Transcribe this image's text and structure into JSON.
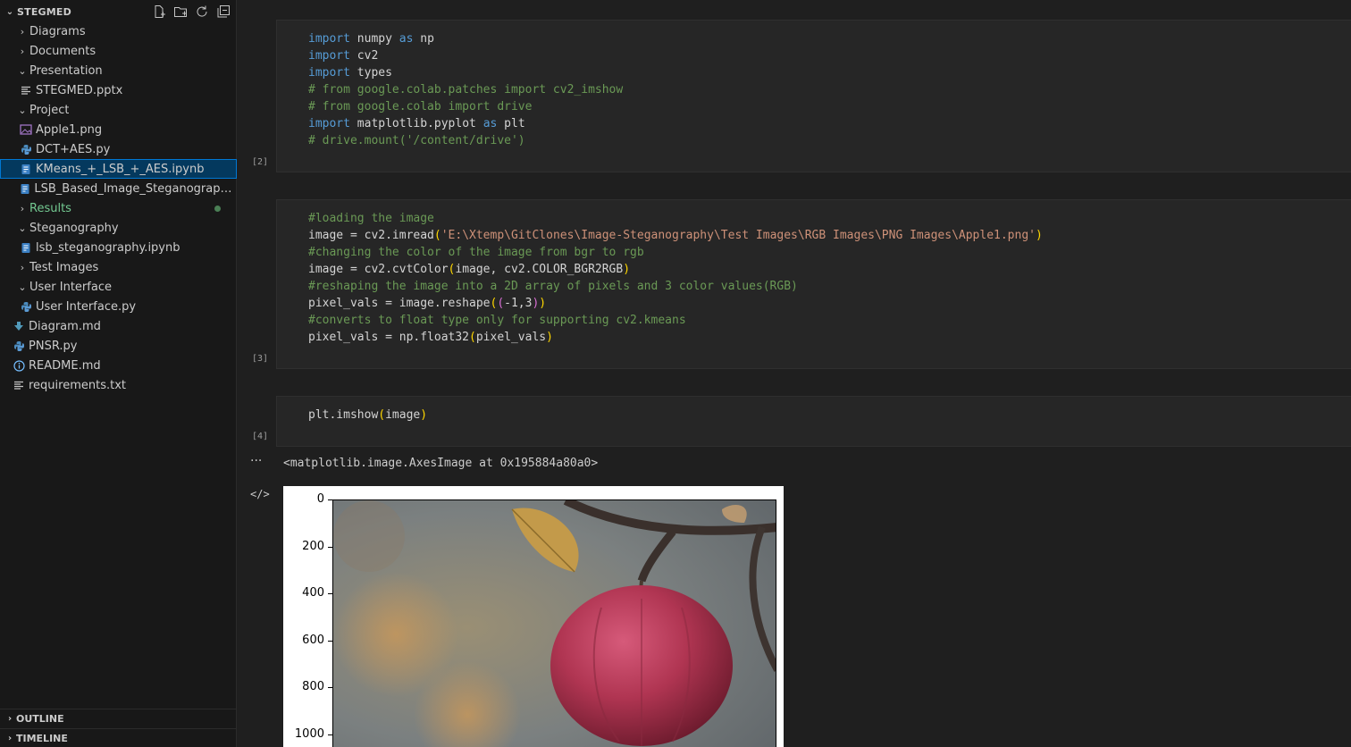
{
  "explorer": {
    "title": "STEGMED",
    "items": [
      {
        "label": "Diagrams",
        "type": "folder",
        "open": false,
        "depth": 0
      },
      {
        "label": "Documents",
        "type": "folder",
        "open": false,
        "depth": 0
      },
      {
        "label": "Presentation",
        "type": "folder",
        "open": true,
        "depth": 0
      },
      {
        "label": "STEGMED.pptx",
        "type": "file-lines",
        "depth": 1
      },
      {
        "label": "Project",
        "type": "folder",
        "open": true,
        "depth": 0
      },
      {
        "label": "Apple1.png",
        "type": "file-image",
        "depth": 1
      },
      {
        "label": "DCT+AES.py",
        "type": "file-python",
        "depth": 1
      },
      {
        "label": "KMeans_+_LSB_+_AES.ipynb",
        "type": "file-notebook",
        "depth": 1,
        "selected": true
      },
      {
        "label": "LSB_Based_Image_Steganography.ipy...",
        "type": "file-notebook",
        "depth": 1
      },
      {
        "label": "Results",
        "type": "folder",
        "open": false,
        "depth": 0,
        "modified": true
      },
      {
        "label": "Steganography",
        "type": "folder",
        "open": true,
        "depth": 0
      },
      {
        "label": "lsb_steganography.ipynb",
        "type": "file-notebook",
        "depth": 1
      },
      {
        "label": "Test Images",
        "type": "folder",
        "open": false,
        "depth": 0
      },
      {
        "label": "User Interface",
        "type": "folder",
        "open": true,
        "depth": 0
      },
      {
        "label": "User Interface.py",
        "type": "file-python",
        "depth": 1
      },
      {
        "label": "Diagram.md",
        "type": "file-markdown",
        "depth": 0
      },
      {
        "label": "PNSR.py",
        "type": "file-python",
        "depth": 0
      },
      {
        "label": "README.md",
        "type": "file-info",
        "depth": 0
      },
      {
        "label": "requirements.txt",
        "type": "file-lines",
        "depth": 0
      }
    ]
  },
  "panes": {
    "outline": "OUTLINE",
    "timeline": "TIMELINE"
  },
  "cells": [
    {
      "exec": "[2]",
      "lines": [
        [
          [
            "kw",
            "import"
          ],
          [
            "t",
            " numpy "
          ],
          [
            "kw",
            "as"
          ],
          [
            "t",
            " np"
          ]
        ],
        [
          [
            "kw",
            "import"
          ],
          [
            "t",
            " cv2"
          ]
        ],
        [
          [
            "kw",
            "import"
          ],
          [
            "t",
            " types"
          ]
        ],
        [
          [
            "cm",
            "# from google.colab.patches import cv2_imshow"
          ]
        ],
        [
          [
            "cm",
            "# from google.colab import drive"
          ]
        ],
        [
          [
            "kw",
            "import"
          ],
          [
            "t",
            " matplotlib.pyplot "
          ],
          [
            "kw",
            "as"
          ],
          [
            "t",
            " plt"
          ]
        ],
        [
          [
            "cm",
            "# drive.mount('/content/drive')"
          ]
        ]
      ]
    },
    {
      "exec": "[3]",
      "lines": [
        [
          [
            "cm",
            "#loading the image"
          ]
        ],
        [
          [
            "t",
            "image = cv2.imread"
          ],
          [
            "p1",
            "("
          ],
          [
            "st",
            "'E:\\Xtemp\\GitClones\\Image-Steganography\\Test Images\\RGB Images\\PNG Images\\Apple1.png'"
          ],
          [
            "p1",
            ")"
          ]
        ],
        [
          [
            "cm",
            "#changing the color of the image from bgr to rgb"
          ]
        ],
        [
          [
            "t",
            "image = cv2.cvtColor"
          ],
          [
            "p1",
            "("
          ],
          [
            "t",
            "image, cv2.COLOR_BGR2RGB"
          ],
          [
            "p1",
            ")"
          ]
        ],
        [
          [
            "cm",
            "#reshaping the image into a 2D array of pixels and 3 color values(RGB)"
          ]
        ],
        [
          [
            "t",
            "pixel_vals = image.reshape"
          ],
          [
            "p1",
            "("
          ],
          [
            "p2",
            "("
          ],
          [
            "t",
            "-1,3"
          ],
          [
            "p2",
            ")"
          ],
          [
            "p1",
            ")"
          ]
        ],
        [
          [
            "cm",
            "#converts to float type only for supporting cv2.kmeans"
          ]
        ],
        [
          [
            "t",
            "pixel_vals = np.float32"
          ],
          [
            "p1",
            "("
          ],
          [
            "t",
            "pixel_vals"
          ],
          [
            "p1",
            ")"
          ]
        ]
      ]
    },
    {
      "exec": "[4]",
      "lines": [
        [
          [
            "t",
            "plt.imshow"
          ],
          [
            "p1",
            "("
          ],
          [
            "t",
            "image"
          ],
          [
            "p1",
            ")"
          ]
        ]
      ]
    }
  ],
  "output": {
    "text": "<matplotlib.image.AxesImage at 0x195884a80a0>",
    "more_icon": "ellipsis-icon",
    "code_icon": "code-icon"
  },
  "chart_data": {
    "type": "image",
    "yticks": [
      "0",
      "200",
      "400",
      "600",
      "800",
      "1000"
    ]
  }
}
